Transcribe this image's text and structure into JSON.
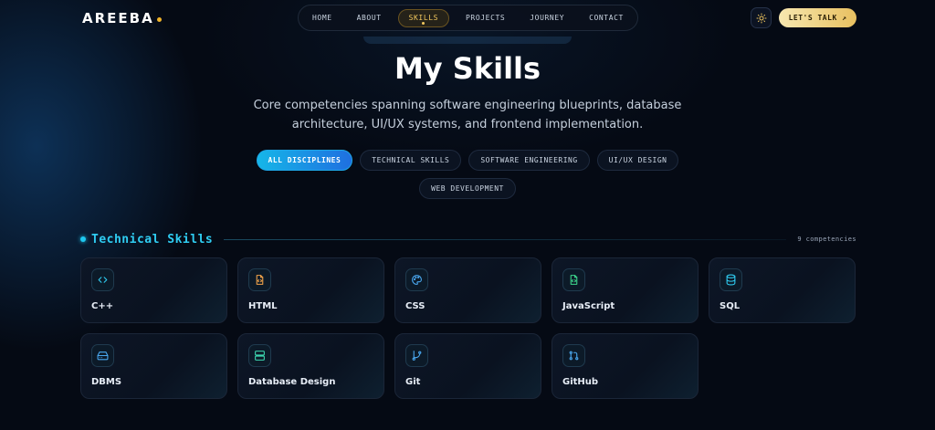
{
  "header": {
    "logo": "AREEBA",
    "nav": [
      "HOME",
      "ABOUT",
      "SKILLS",
      "PROJECTS",
      "JOURNEY",
      "CONTACT"
    ],
    "active_nav": "SKILLS",
    "theme_icon": "sun-icon",
    "cta_label": "LET'S TALK ↗"
  },
  "hero": {
    "title": "My Skills",
    "subtitle": "Core competencies spanning software engineering blueprints, database architecture, UI/UX systems, and frontend implementation."
  },
  "filters": {
    "items": [
      "ALL DISCIPLINES",
      "TECHNICAL SKILLS",
      "SOFTWARE ENGINEERING",
      "UI/UX DESIGN",
      "WEB DEVELOPMENT"
    ],
    "active": "ALL DISCIPLINES"
  },
  "section": {
    "title": "Technical Skills",
    "count": "9 competencies"
  },
  "skills": [
    {
      "label": "C++",
      "icon": "code-icon"
    },
    {
      "label": "HTML",
      "icon": "file-code-icon"
    },
    {
      "label": "CSS",
      "icon": "palette-icon"
    },
    {
      "label": "JavaScript",
      "icon": "file-code-icon"
    },
    {
      "label": "SQL",
      "icon": "database-icon"
    },
    {
      "label": "DBMS",
      "icon": "hard-drive-icon"
    },
    {
      "label": "Database Design",
      "icon": "server-icon"
    },
    {
      "label": "Git",
      "icon": "git-branch-icon"
    },
    {
      "label": "GitHub",
      "icon": "git-pull-request-icon"
    }
  ],
  "colors": {
    "accent": "#1ec8f0",
    "gold": "#f0c75e",
    "background": "#050a14"
  }
}
